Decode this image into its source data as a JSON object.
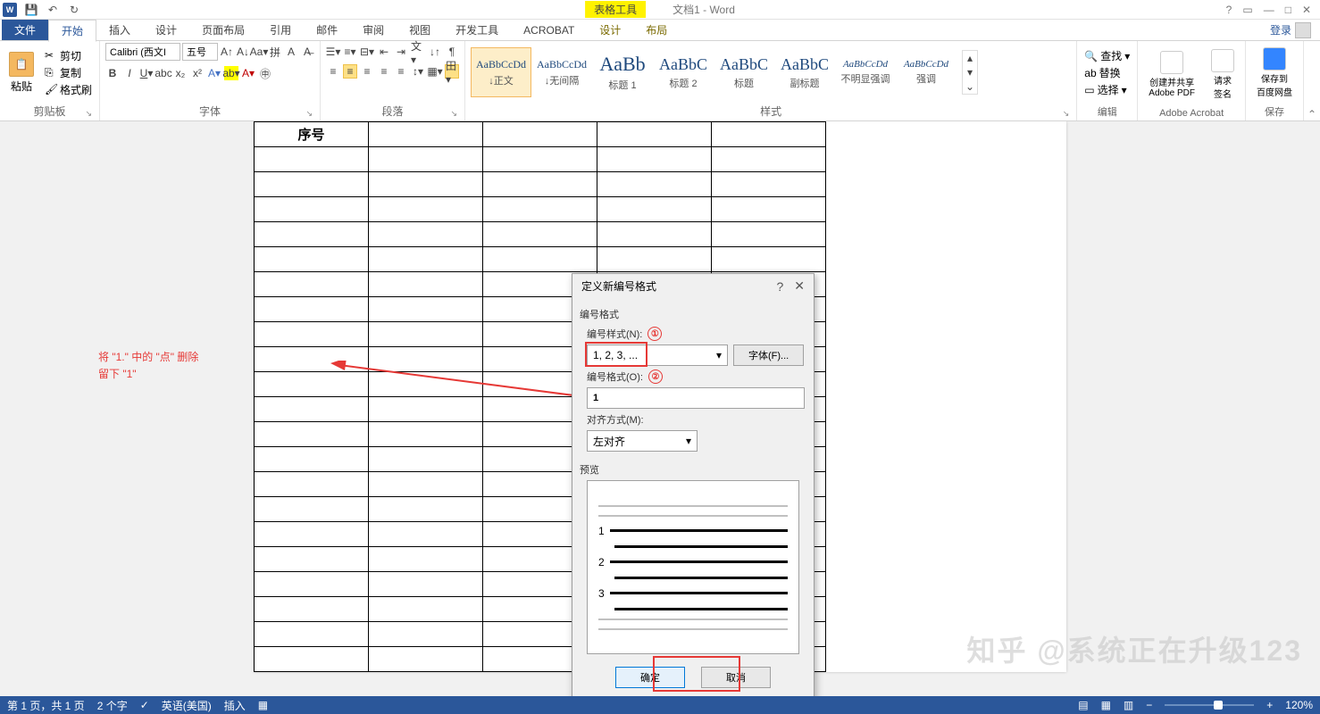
{
  "titlebar": {
    "table_tools": "表格工具",
    "doc_title": "文档1 - Word"
  },
  "tabs": {
    "file": "文件",
    "home": "开始",
    "insert": "插入",
    "design": "设计",
    "layout": "页面布局",
    "references": "引用",
    "mailings": "邮件",
    "review": "审阅",
    "view": "视图",
    "developer": "开发工具",
    "acrobat": "ACROBAT",
    "tbl_design": "设计",
    "tbl_layout": "布局",
    "login": "登录"
  },
  "clipboard": {
    "paste": "粘贴",
    "cut": "剪切",
    "copy": "复制",
    "painter": "格式刷",
    "label": "剪贴板"
  },
  "font": {
    "name": "Calibri (西文I",
    "size": "五号",
    "label": "字体"
  },
  "paragraph": {
    "label": "段落"
  },
  "styles": {
    "label": "样式",
    "items": [
      {
        "prev": "AaBbCcDd",
        "name": "↓正文",
        "s": 12,
        "sel": true
      },
      {
        "prev": "AaBbCcDd",
        "name": "↓无间隔",
        "s": 12
      },
      {
        "prev": "AaBb",
        "name": "标题 1",
        "s": 22
      },
      {
        "prev": "AaBbC",
        "name": "标题 2",
        "s": 18
      },
      {
        "prev": "AaBbC",
        "name": "标题",
        "s": 18
      },
      {
        "prev": "AaBbC",
        "name": "副标题",
        "s": 18
      },
      {
        "prev": "AaBbCcDd",
        "name": "不明显强调",
        "s": 11,
        "i": true
      },
      {
        "prev": "AaBbCcDd",
        "name": "强调",
        "s": 11,
        "i": true
      }
    ]
  },
  "editing": {
    "find": "查找",
    "replace": "替换",
    "select": "选择",
    "label": "编辑"
  },
  "adobe": {
    "create": "创建并共享\nAdobe PDF",
    "request": "请求\n签名",
    "label": "Adobe Acrobat"
  },
  "baidu": {
    "save": "保存到\n百度网盘",
    "label": "保存"
  },
  "document": {
    "header": "序号"
  },
  "annotation": {
    "line1": "将 \"1.\" 中的 \"点\" 删除",
    "line2": "留下 \"1\""
  },
  "dialog": {
    "title": "定义新编号格式",
    "section_format": "编号格式",
    "style_label": "编号样式(N):",
    "style_value": "1, 2, 3, ...",
    "font_btn": "字体(F)...",
    "format_label": "编号格式(O):",
    "format_value": "1",
    "align_label": "对齐方式(M):",
    "align_value": "左对齐",
    "preview": "预览",
    "ok": "确定",
    "cancel": "取消",
    "num1": "①",
    "num2": "②"
  },
  "status": {
    "page": "第 1 页，共 1 页",
    "words": "2 个字",
    "lang": "英语(美国)",
    "ins": "插入",
    "zoom": "120%"
  },
  "watermark": "知乎 @系统正在升级123"
}
